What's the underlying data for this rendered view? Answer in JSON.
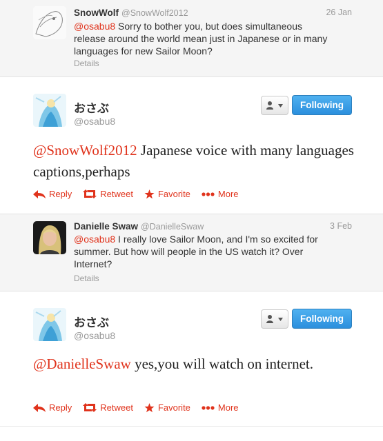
{
  "tweet1": {
    "name": "SnowWolf",
    "handle": "@SnowWolf2012",
    "date": "26 Jan",
    "mention": "@osabu8",
    "text": " Sorry to bother you, but does simultaneous release around the world mean just in Japanese or in many languages for new Sailor Moon?",
    "details": "Details"
  },
  "reply1": {
    "name": "おさぶ",
    "handle": "@osabu8",
    "follow_label": "Following",
    "mention": "@SnowWolf2012",
    "text": " Japanese voice with many languages captions,perhaps",
    "actions": {
      "reply": "Reply",
      "retweet": "Retweet",
      "favorite": "Favorite",
      "more": "More"
    }
  },
  "tweet2": {
    "name": "Danielle Swaw",
    "handle": "@DanielleSwaw",
    "date": "3 Feb",
    "mention": "@osabu8",
    "text": " I really love Sailor Moon, and I'm so excited for summer. But how will people in the US watch it? Over Internet?",
    "details": "Details"
  },
  "reply2": {
    "name": "おさぶ",
    "handle": "@osabu8",
    "follow_label": "Following",
    "mention": "@DanielleSwaw",
    "text": " yes,you will watch on internet.",
    "actions": {
      "reply": "Reply",
      "retweet": "Retweet",
      "favorite": "Favorite",
      "more": "More"
    }
  },
  "colors": {
    "accent": "#e0331c",
    "follow_button": "#2b8fdd",
    "reply_background": "#f5f5f5"
  },
  "icons": [
    "reply-icon",
    "retweet-icon",
    "favorite-icon",
    "more-icon",
    "user-icon",
    "caret-down-icon"
  ]
}
